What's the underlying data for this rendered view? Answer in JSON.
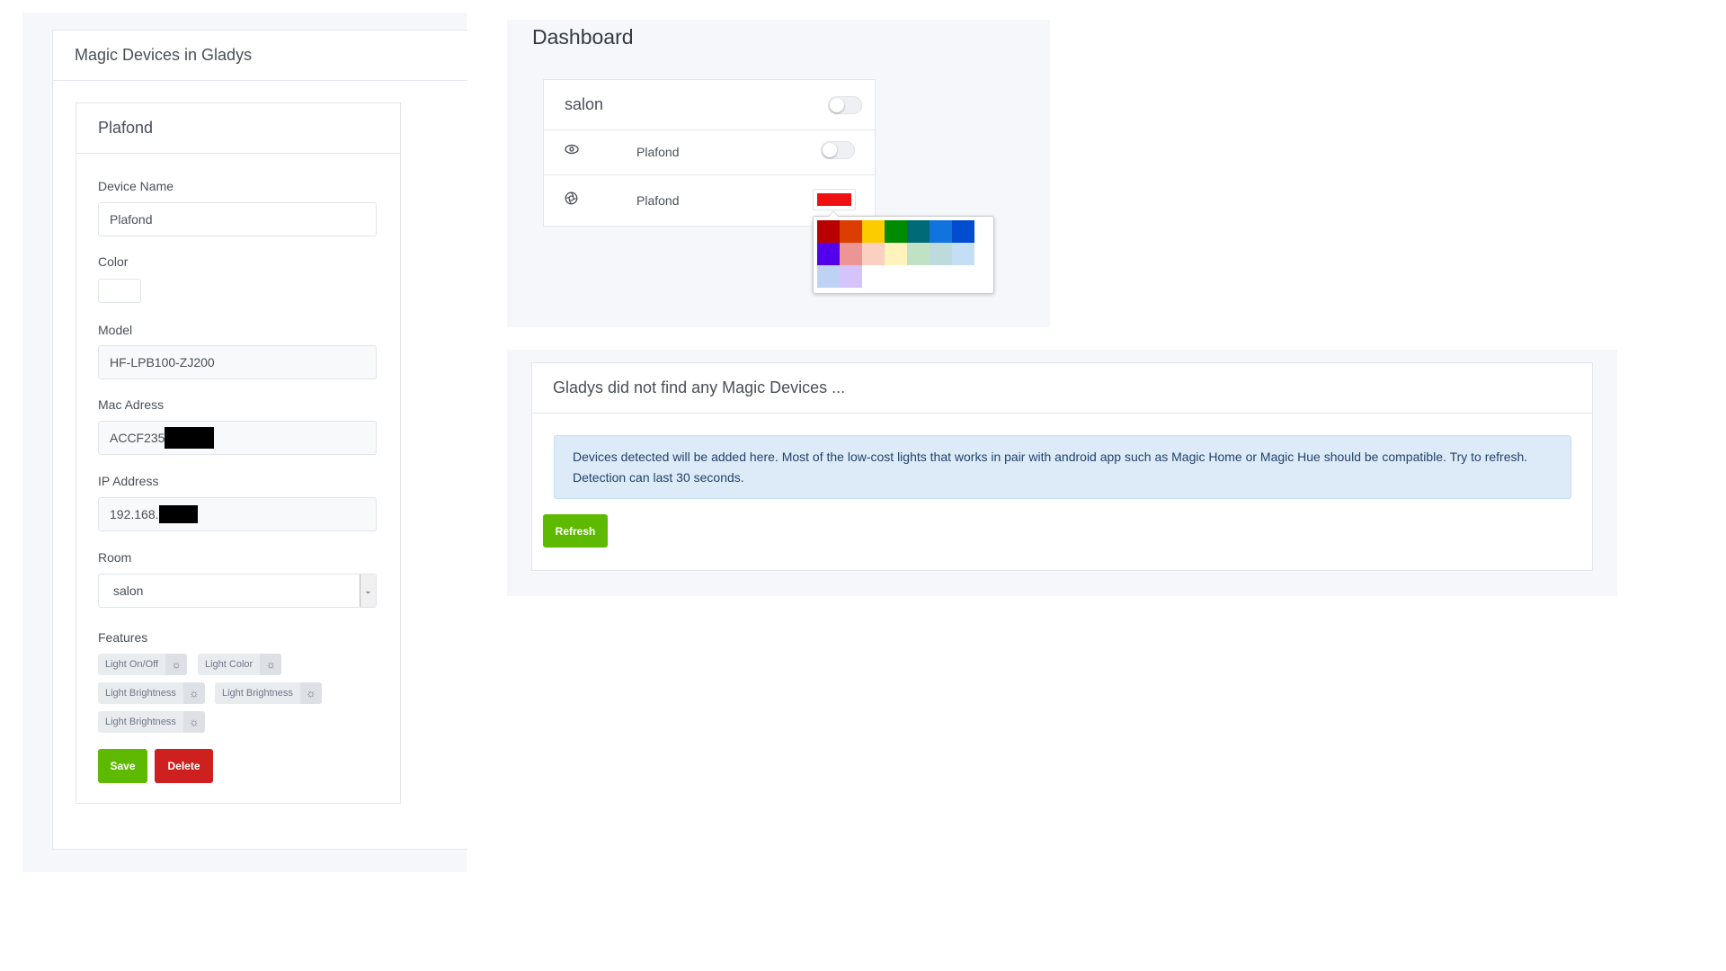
{
  "left_panel": {
    "title": "Magic Devices in Gladys",
    "device": {
      "card_title": "Plafond",
      "name_label": "Device Name",
      "name_value": "Plafond",
      "color_label": "Color",
      "model_label": "Model",
      "model_value": "HF-LPB100-ZJ200",
      "mac_label": "Mac Adress",
      "mac_value": "ACCF235",
      "ip_label": "IP Address",
      "ip_value": "192.168.",
      "room_label": "Room",
      "room_value": "salon",
      "features_label": "Features",
      "features": [
        "Light On/Off",
        "Light Color",
        "Light Brightness",
        "Light Brightness",
        "Light Brightness"
      ],
      "save_label": "Save",
      "delete_label": "Delete"
    }
  },
  "dashboard": {
    "title": "Dashboard",
    "room": "salon",
    "devices": [
      {
        "name": "Plafond",
        "icon": "eye-icon",
        "control": "toggle"
      },
      {
        "name": "Plafond",
        "icon": "aperture-icon",
        "control": "color"
      }
    ],
    "selected_color": "#ef1111",
    "picker_colors": [
      "#b80000",
      "#db3e00",
      "#fccb00",
      "#008b02",
      "#006b76",
      "#1273de",
      "#004dcf",
      "#5300eb",
      "#eb9694",
      "#fad0c3",
      "#fef3bd",
      "#c1e1c5",
      "#bedadc",
      "#c4def6",
      "#bed3f3",
      "#d4c4fb"
    ]
  },
  "magic_search": {
    "title": "Gladys did not find any Magic Devices ...",
    "alert_line1": "Devices detected will be added here. Most of the low-cost lights that works in pair with android app such as Magic Home or Magic Hue should be compatible. Try to refresh.",
    "alert_line2": "Detection can last 30 seconds.",
    "refresh_label": "Refresh"
  },
  "colors": {
    "green": "#5eba00",
    "red": "#cd201f",
    "alert_bg": "#dcebf7"
  }
}
